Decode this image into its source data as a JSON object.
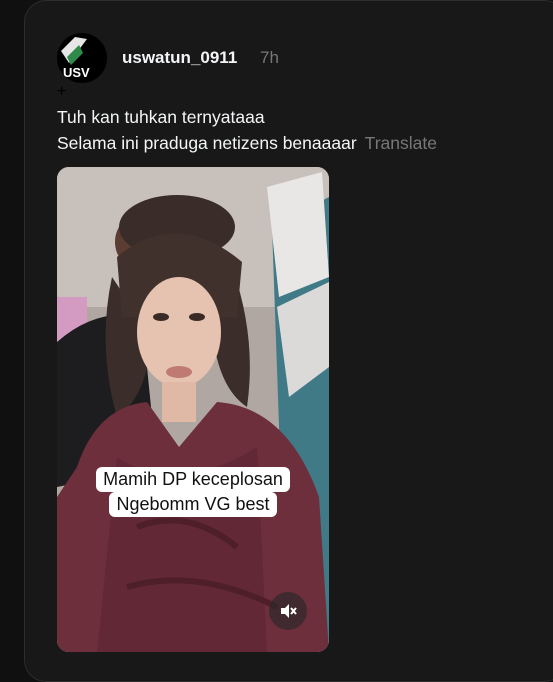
{
  "post": {
    "username": "uswatun_0911",
    "avatar_text": "USV",
    "time": "7h",
    "caption_line1": "Tuh kan tuhkan ternyataaa",
    "caption_line2": "Selama ini praduga netizens benaaaar",
    "translate_label": "Translate"
  },
  "video": {
    "subtitle_line1": "Mamih DP keceplosan",
    "subtitle_line2": "Ngebomm VG best",
    "mute_icon": "speaker-muted-icon"
  }
}
